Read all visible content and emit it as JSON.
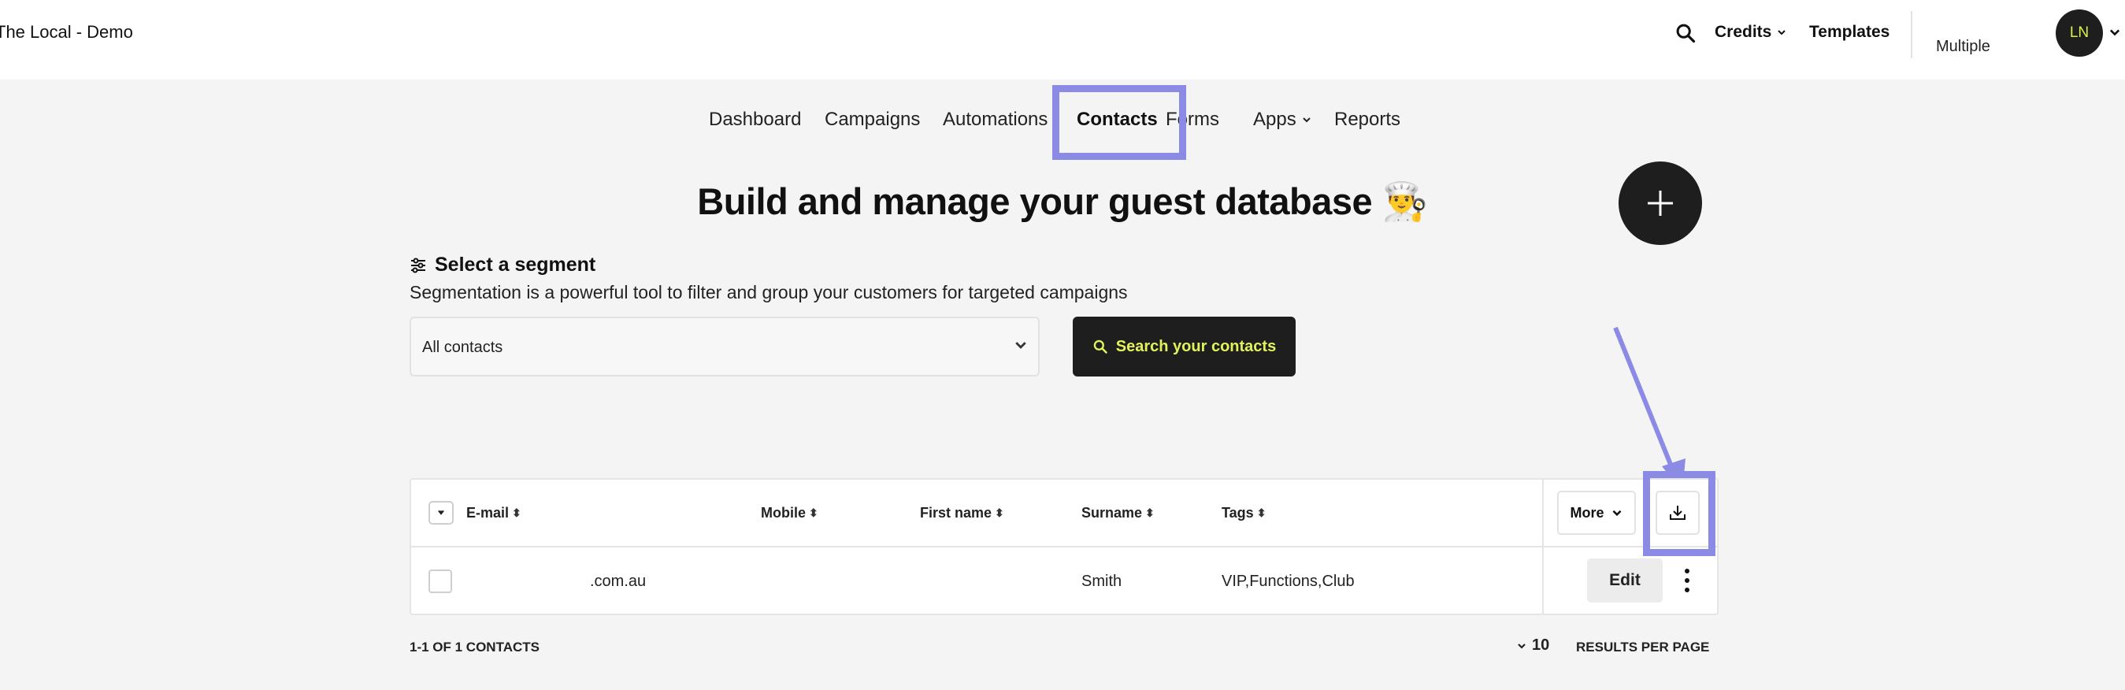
{
  "topbar": {
    "brand": "The Local - Demo",
    "credits_label": "Credits",
    "templates_label": "Templates",
    "account_label": "Multiple",
    "avatar_initials": "LN"
  },
  "nav": {
    "items": [
      {
        "label": "Dashboard"
      },
      {
        "label": "Campaigns"
      },
      {
        "label": "Automations"
      },
      {
        "label": "Contacts",
        "active": true
      },
      {
        "label": "Forms"
      },
      {
        "label": "Apps"
      },
      {
        "label": "Reports"
      }
    ]
  },
  "page": {
    "title": "Build and manage your guest database 👨‍🍳",
    "add_icon": "plus-icon"
  },
  "segment": {
    "title": "Select a segment",
    "description": "Segmentation is a powerful tool to filter and group your customers for targeted campaigns",
    "selected": "All contacts",
    "search_button": "Search your contacts"
  },
  "table": {
    "columns": [
      "E-mail",
      "Mobile",
      "First name",
      "Surname",
      "Tags"
    ],
    "more_label": "More",
    "rows": [
      {
        "email": ".com.au",
        "mobile": "",
        "first_name": "",
        "surname": "Smith",
        "tags": "VIP,Functions,Club",
        "edit_label": "Edit"
      }
    ]
  },
  "pagination": {
    "summary": "1-1 OF 1 CONTACTS",
    "per_page": "10",
    "per_page_label": "RESULTS PER PAGE"
  },
  "colors": {
    "highlight": "#8b8be6",
    "accent": "#e1f25a",
    "dark": "#1e1e1e"
  }
}
